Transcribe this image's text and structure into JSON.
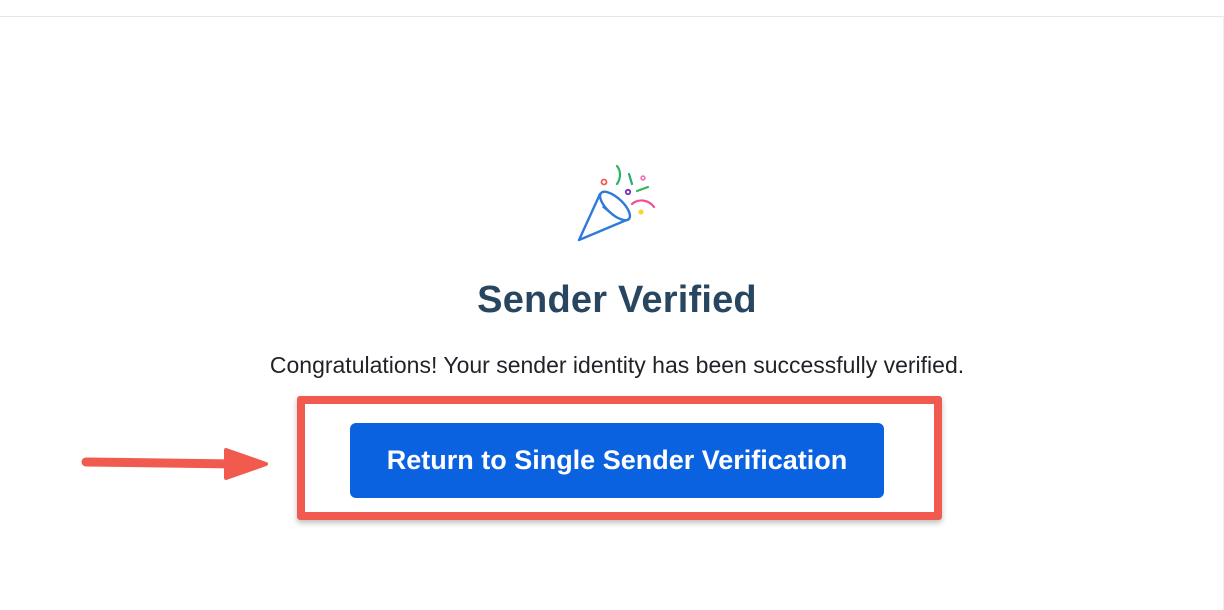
{
  "header": {
    "divider": true
  },
  "confirmation": {
    "icon": "party-popper-icon",
    "title": "Sender Verified",
    "message": "Congratulations! Your sender identity has been successfully verified.",
    "button_label": "Return to Single Sender Verification"
  },
  "annotation": {
    "highlight_color": "#f05a4f",
    "arrow_color": "#f05a4f",
    "button_color": "#0b62e0",
    "title_color": "#294661"
  }
}
